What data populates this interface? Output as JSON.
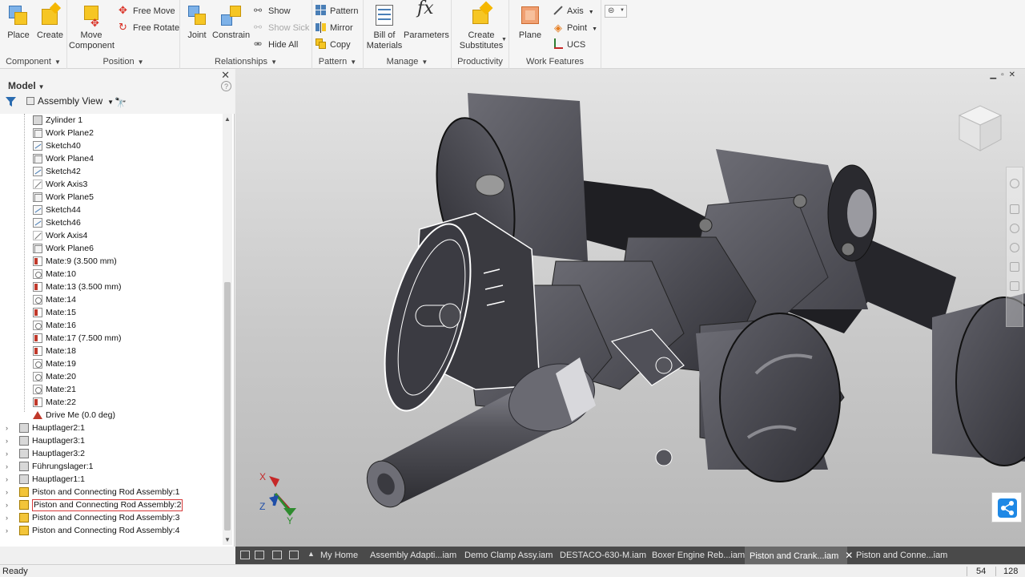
{
  "ribbon": {
    "component": {
      "label": "Component",
      "place": "Place",
      "create": "Create"
    },
    "position": {
      "label": "Position",
      "move_component": "Move\nComponent",
      "free_move": "Free Move",
      "free_rotate": "Free Rotate"
    },
    "relationships": {
      "label": "Relationships",
      "joint": "Joint",
      "constrain": "Constrain",
      "show": "Show",
      "show_sick": "Show Sick",
      "hide_all": "Hide All"
    },
    "pattern": {
      "label": "Pattern",
      "pattern": "Pattern",
      "mirror": "Mirror",
      "copy": "Copy"
    },
    "manage": {
      "label": "Manage",
      "bill_of_materials": "Bill of\nMaterials",
      "parameters": "Parameters"
    },
    "productivity": {
      "label": "Productivity",
      "create_substitutes": "Create\nSubstitutes"
    },
    "work_features": {
      "label": "Work Features",
      "plane": "Plane",
      "axis": "Axis",
      "point": "Point",
      "ucs": "UCS"
    }
  },
  "browser": {
    "title": "Model",
    "view": "Assembly View",
    "items": [
      {
        "label": "Zylinder 1",
        "icon": "part-icon"
      },
      {
        "label": "Work Plane2",
        "icon": "work-plane-icon"
      },
      {
        "label": "Sketch40",
        "icon": "sketch-icon"
      },
      {
        "label": "Work Plane4",
        "icon": "work-plane-icon"
      },
      {
        "label": "Sketch42",
        "icon": "sketch-icon"
      },
      {
        "label": "Work Axis3",
        "icon": "work-axis-icon"
      },
      {
        "label": "Work Plane5",
        "icon": "work-plane-icon"
      },
      {
        "label": "Sketch44",
        "icon": "sketch-icon"
      },
      {
        "label": "Sketch46",
        "icon": "sketch-icon"
      },
      {
        "label": "Work Axis4",
        "icon": "work-axis-icon"
      },
      {
        "label": "Work Plane6",
        "icon": "work-plane-icon"
      },
      {
        "label": "Mate:9 (3.500 mm)",
        "icon": "flush-constraint-icon"
      },
      {
        "label": "Mate:10",
        "icon": "mate-constraint-icon"
      },
      {
        "label": "Mate:13 (3.500 mm)",
        "icon": "flush-constraint-icon"
      },
      {
        "label": "Mate:14",
        "icon": "mate-constraint-icon"
      },
      {
        "label": "Mate:15",
        "icon": "flush-constraint-icon"
      },
      {
        "label": "Mate:16",
        "icon": "mate-constraint-icon"
      },
      {
        "label": "Mate:17 (7.500 mm)",
        "icon": "flush-constraint-icon"
      },
      {
        "label": "Mate:18",
        "icon": "flush-constraint-icon"
      },
      {
        "label": "Mate:19",
        "icon": "mate-constraint-icon"
      },
      {
        "label": "Mate:20",
        "icon": "mate-constraint-icon"
      },
      {
        "label": "Mate:21",
        "icon": "mate-constraint-icon"
      },
      {
        "label": "Mate:22",
        "icon": "flush-constraint-icon"
      },
      {
        "label": "Drive Me (0.0 deg)",
        "icon": "angle-constraint-icon"
      }
    ],
    "components": [
      {
        "label": "Hauptlager2:1",
        "icon": "part-icon",
        "selected": false
      },
      {
        "label": "Hauptlager3:1",
        "icon": "part-icon",
        "selected": false
      },
      {
        "label": "Hauptlager3:2",
        "icon": "part-icon",
        "selected": false
      },
      {
        "label": "Führungslager:1",
        "icon": "part-icon",
        "selected": false
      },
      {
        "label": "Hauptlager1:1",
        "icon": "part-icon",
        "selected": false
      },
      {
        "label": "Piston and Connecting Rod Assembly:1",
        "icon": "assembly-icon",
        "selected": false
      },
      {
        "label": "Piston and Connecting Rod Assembly:2",
        "icon": "assembly-icon",
        "selected": true
      },
      {
        "label": "Piston and Connecting Rod Assembly:3",
        "icon": "assembly-icon",
        "selected": false
      },
      {
        "label": "Piston and Connecting Rod Assembly:4",
        "icon": "assembly-icon",
        "selected": false
      }
    ]
  },
  "viewport": {
    "triad_x": "X",
    "triad_y": "Y",
    "triad_z": "Z"
  },
  "doc_tabs": [
    {
      "label": "My Home",
      "active": false
    },
    {
      "label": "Assembly Adapti...iam",
      "active": false
    },
    {
      "label": "Demo Clamp Assy.iam",
      "active": false
    },
    {
      "label": "DESTACO-630-M.iam",
      "active": false
    },
    {
      "label": "Boxer Engine Reb...iam",
      "active": false
    },
    {
      "label": "Piston and Crank...iam",
      "active": true
    },
    {
      "label": "Piston and Conne...iam",
      "active": false
    }
  ],
  "status": {
    "text": "Ready",
    "value1": "54",
    "value2": "128"
  },
  "colors": {
    "accent": "#1e88e5",
    "selection": "#d63a3a",
    "tab_bar": "#4a4a4a"
  }
}
